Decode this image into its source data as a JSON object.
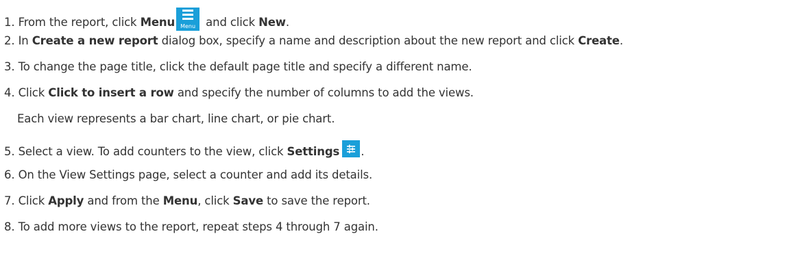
{
  "steps": [
    {
      "num": "1.",
      "parts": [
        {
          "t": "From the report, click "
        },
        {
          "b": "Menu"
        },
        {
          "icon": "menu-icon"
        },
        {
          "t": " and click "
        },
        {
          "b": "New"
        },
        {
          "t": "."
        }
      ]
    },
    {
      "num": "2.",
      "parts": [
        {
          "t": "In "
        },
        {
          "b": "Create a new report"
        },
        {
          "t": " dialog box, specify a name and description about the new report and click "
        },
        {
          "b": "Create"
        },
        {
          "t": "."
        }
      ]
    },
    {
      "num": "3.",
      "parts": [
        {
          "t": "To change the page title, click the default page title and specify a different name."
        }
      ]
    },
    {
      "num": "4.",
      "parts": [
        {
          "t": "Click "
        },
        {
          "b": "Click to insert a row"
        },
        {
          "t": " and specify the number of columns to add the views."
        }
      ],
      "note": "Each view represents a bar chart, line chart, or pie chart."
    },
    {
      "num": "5.",
      "parts": [
        {
          "t": "Select a view. To add counters to the view, click "
        },
        {
          "b": "Settings"
        },
        {
          "icon": "settings-icon"
        },
        {
          "t": "."
        }
      ]
    },
    {
      "num": "6.",
      "parts": [
        {
          "t": "On the View Settings page, select a counter and add its details."
        }
      ]
    },
    {
      "num": "7.",
      "parts": [
        {
          "t": "Click "
        },
        {
          "b": "Apply"
        },
        {
          "t": " and from the "
        },
        {
          "b": "Menu"
        },
        {
          "t": ", click "
        },
        {
          "b": "Save"
        },
        {
          "t": " to save the report."
        }
      ]
    },
    {
      "num": "8.",
      "parts": [
        {
          "t": "To add more views to the report, repeat steps 4 through 7 again."
        }
      ]
    }
  ],
  "icons": {
    "menu_caption": "Menu",
    "accent": "#1a9fd9"
  }
}
